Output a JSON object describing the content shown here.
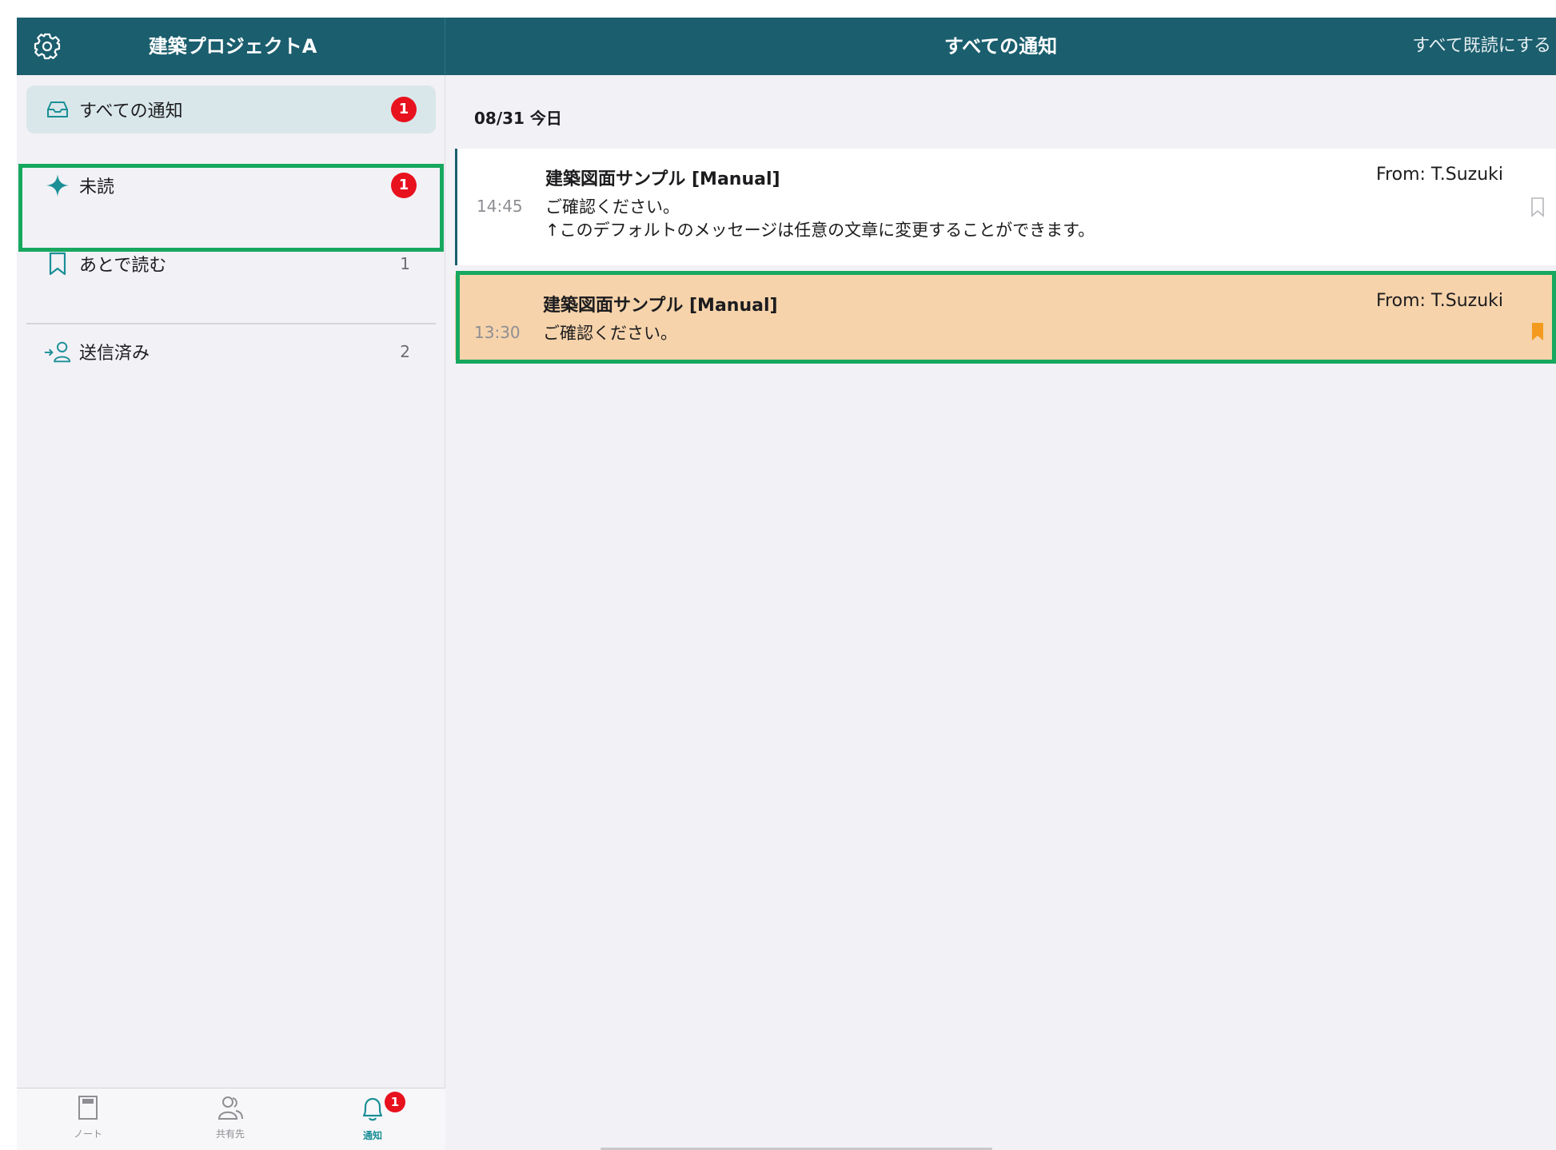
{
  "header": {
    "project_title": "建築プロジェクトA",
    "main_title": "すべての通知",
    "mark_all_read": "すべて既読にする"
  },
  "sidebar": {
    "items": [
      {
        "label": "すべての通知",
        "icon": "inbox-icon",
        "badge": "1",
        "active": true
      },
      {
        "label": "未読",
        "icon": "sparkle-icon",
        "badge": "1"
      },
      {
        "label": "あとで読む",
        "icon": "bookmark-icon",
        "count": "1"
      },
      {
        "label": "送信済み",
        "icon": "sent-person-icon",
        "count": "2"
      }
    ]
  },
  "tabbar": {
    "tabs": [
      {
        "label": "ノート",
        "icon": "note-icon"
      },
      {
        "label": "共有先",
        "icon": "people-icon"
      },
      {
        "label": "通知",
        "icon": "bell-icon",
        "badge": "1",
        "active": true
      }
    ]
  },
  "main": {
    "date_header": "08/31 今日",
    "notifications": [
      {
        "time": "14:45",
        "subject": "建築図面サンプル [Manual]",
        "from": "From: T.Suzuki",
        "line1": "ご確認ください。",
        "line2": "↑このデフォルトのメッセージは任意の文章に変更することができます。",
        "bookmarked": false
      },
      {
        "time": "13:30",
        "subject": "建築図面サンプル [Manual]",
        "from": "From: T.Suzuki",
        "line1": "ご確認ください。",
        "bookmarked": true
      }
    ]
  },
  "colors": {
    "header_bg": "#1b5e6e",
    "accent": "#1a8f96",
    "badge": "#e8111e",
    "highlight_row": "#f6d3ab",
    "bookmark_active": "#f39a1e",
    "selection_border": "#16a85e"
  }
}
